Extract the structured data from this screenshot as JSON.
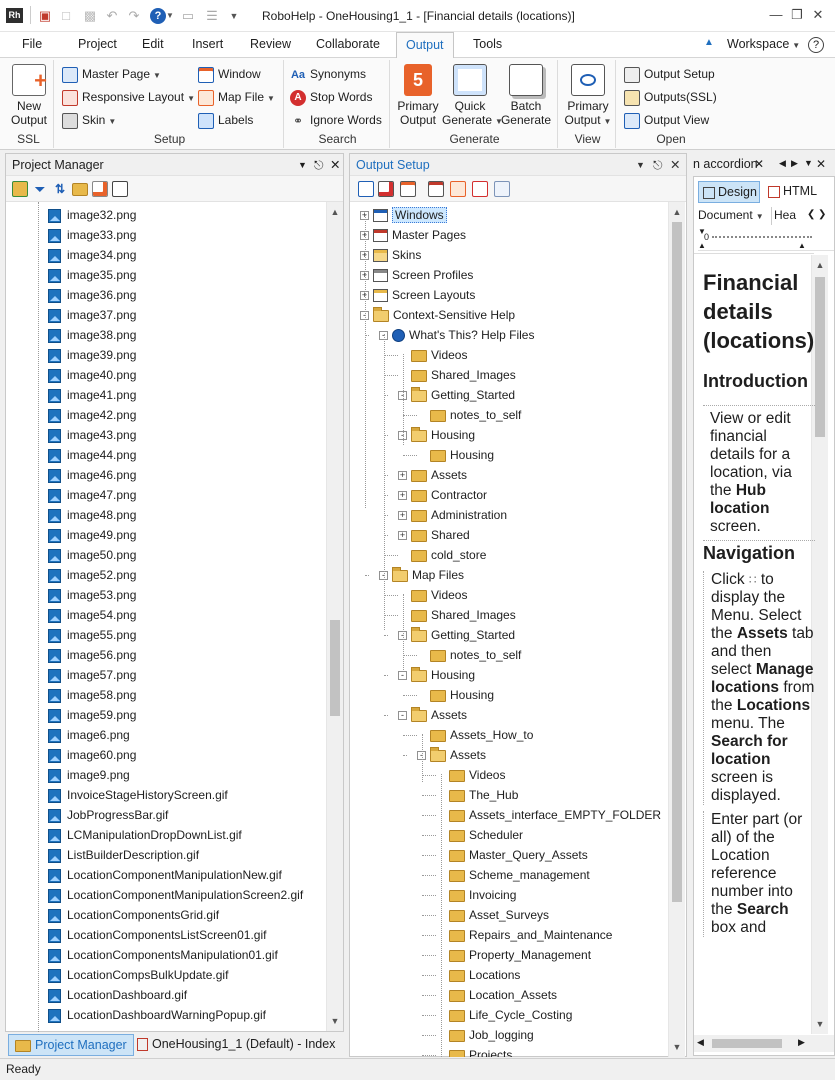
{
  "window": {
    "app_icon": "Rh",
    "title": "RoboHelp - OneHousing1_1 - [Financial details (locations)]"
  },
  "menu_tabs": [
    "File",
    "Project",
    "Edit",
    "Insert",
    "Review",
    "Collaborate",
    "Output",
    "Tools"
  ],
  "active_tab": "Output",
  "workspace_label": "Workspace",
  "ribbon": {
    "ssl": {
      "button": "New Output",
      "group": "SSL"
    },
    "setup": {
      "items": [
        "Master Page",
        "Responsive Layout",
        "Skin",
        "Window",
        "Map File",
        "Labels"
      ],
      "group": "Setup"
    },
    "search": {
      "items": [
        "Synonyms",
        "Stop Words",
        "Ignore Words"
      ],
      "group": "Search"
    },
    "generate": {
      "buttons": [
        "Primary Output",
        "Quick Generate",
        "Batch Generate"
      ],
      "group": "Generate"
    },
    "view": {
      "button": "Primary Output",
      "group": "View"
    },
    "open": {
      "items": [
        "Output Setup",
        "Outputs(SSL)",
        "Output View"
      ],
      "group": "Open"
    }
  },
  "project_manager": {
    "title": "Project Manager",
    "files": [
      "image32.png",
      "image33.png",
      "image34.png",
      "image35.png",
      "image36.png",
      "image37.png",
      "image38.png",
      "image39.png",
      "image40.png",
      "image41.png",
      "image42.png",
      "image43.png",
      "image44.png",
      "image46.png",
      "image47.png",
      "image48.png",
      "image49.png",
      "image50.png",
      "image52.png",
      "image53.png",
      "image54.png",
      "image55.png",
      "image56.png",
      "image57.png",
      "image58.png",
      "image59.png",
      "image6.png",
      "image60.png",
      "image9.png",
      "InvoiceStageHistoryScreen.gif",
      "JobProgressBar.gif",
      "LCManipulationDropDownList.gif",
      "ListBuilderDescription.gif",
      "LocationComponentManipulationNew.gif",
      "LocationComponentManipulationScreen2.gif",
      "LocationComponentsGrid.gif",
      "LocationComponentsListScreen01.gif",
      "LocationComponentsManipulation01.gif",
      "LocationCompsBulkUpdate.gif",
      "LocationDashboard.gif",
      "LocationDashboardWarningPopup.gif"
    ]
  },
  "output_setup": {
    "title": "Output Setup",
    "tree": [
      {
        "label": "Windows",
        "depth": 0,
        "exp": "+",
        "icon": "window",
        "selected": true
      },
      {
        "label": "Master Pages",
        "depth": 0,
        "exp": "+",
        "icon": "page"
      },
      {
        "label": "Skins",
        "depth": 0,
        "exp": "+",
        "icon": "skin"
      },
      {
        "label": "Screen Profiles",
        "depth": 0,
        "exp": "+",
        "icon": "profile"
      },
      {
        "label": "Screen Layouts",
        "depth": 0,
        "exp": "+",
        "icon": "layout"
      },
      {
        "label": "Context-Sensitive Help",
        "depth": 0,
        "exp": "-",
        "icon": "open"
      },
      {
        "label": "What's This? Help Files",
        "depth": 1,
        "exp": "-",
        "icon": "help"
      },
      {
        "label": "Videos",
        "depth": 2,
        "exp": "",
        "icon": "folder"
      },
      {
        "label": "Shared_Images",
        "depth": 2,
        "exp": "",
        "icon": "folder"
      },
      {
        "label": "Getting_Started",
        "depth": 2,
        "exp": "-",
        "icon": "open"
      },
      {
        "label": "notes_to_self",
        "depth": 3,
        "exp": "",
        "icon": "folder"
      },
      {
        "label": "Housing",
        "depth": 2,
        "exp": "-",
        "icon": "open"
      },
      {
        "label": "Housing",
        "depth": 3,
        "exp": "",
        "icon": "folder"
      },
      {
        "label": "Assets",
        "depth": 2,
        "exp": "+",
        "icon": "folder"
      },
      {
        "label": "Contractor",
        "depth": 2,
        "exp": "+",
        "icon": "folder"
      },
      {
        "label": "Administration",
        "depth": 2,
        "exp": "+",
        "icon": "folder"
      },
      {
        "label": "Shared",
        "depth": 2,
        "exp": "+",
        "icon": "folder"
      },
      {
        "label": "cold_store",
        "depth": 2,
        "exp": "",
        "icon": "folder"
      },
      {
        "label": "Map Files",
        "depth": 1,
        "exp": "-",
        "icon": "open"
      },
      {
        "label": "Videos",
        "depth": 2,
        "exp": "",
        "icon": "folder"
      },
      {
        "label": "Shared_Images",
        "depth": 2,
        "exp": "",
        "icon": "folder"
      },
      {
        "label": "Getting_Started",
        "depth": 2,
        "exp": "-",
        "icon": "open"
      },
      {
        "label": "notes_to_self",
        "depth": 3,
        "exp": "",
        "icon": "folder"
      },
      {
        "label": "Housing",
        "depth": 2,
        "exp": "-",
        "icon": "open"
      },
      {
        "label": "Housing",
        "depth": 3,
        "exp": "",
        "icon": "folder"
      },
      {
        "label": "Assets",
        "depth": 2,
        "exp": "-",
        "icon": "open"
      },
      {
        "label": "Assets_How_to",
        "depth": 3,
        "exp": "",
        "icon": "folder"
      },
      {
        "label": "Assets",
        "depth": 3,
        "exp": "-",
        "icon": "open"
      },
      {
        "label": "Videos",
        "depth": 4,
        "exp": "",
        "icon": "folder"
      },
      {
        "label": "The_Hub",
        "depth": 4,
        "exp": "",
        "icon": "folder"
      },
      {
        "label": "Assets_interface_EMPTY_FOLDER",
        "depth": 4,
        "exp": "",
        "icon": "folder"
      },
      {
        "label": "Scheduler",
        "depth": 4,
        "exp": "",
        "icon": "folder"
      },
      {
        "label": "Master_Query_Assets",
        "depth": 4,
        "exp": "",
        "icon": "folder"
      },
      {
        "label": "Scheme_management",
        "depth": 4,
        "exp": "",
        "icon": "folder"
      },
      {
        "label": "Invoicing",
        "depth": 4,
        "exp": "",
        "icon": "folder"
      },
      {
        "label": "Asset_Surveys",
        "depth": 4,
        "exp": "",
        "icon": "folder"
      },
      {
        "label": "Repairs_and_Maintenance",
        "depth": 4,
        "exp": "",
        "icon": "folder"
      },
      {
        "label": "Property_Management",
        "depth": 4,
        "exp": "",
        "icon": "folder"
      },
      {
        "label": "Locations",
        "depth": 4,
        "exp": "",
        "icon": "folder"
      },
      {
        "label": "Location_Assets",
        "depth": 4,
        "exp": "",
        "icon": "folder"
      },
      {
        "label": "Life_Cycle_Costing",
        "depth": 4,
        "exp": "",
        "icon": "folder"
      },
      {
        "label": "Job_logging",
        "depth": 4,
        "exp": "",
        "icon": "folder"
      },
      {
        "label": "Projects",
        "depth": 4,
        "exp": "",
        "icon": "folder"
      }
    ]
  },
  "editor": {
    "tab_title": "n accordion",
    "design_label": "Design",
    "html_label": "HTML",
    "style_select": "Document",
    "style_select2": "Hea",
    "ruler_zero": "0",
    "heading": "Financial details (locations)",
    "intro_heading": "Introduction",
    "intro_text_pre": "View or edit financial details for a location, via the ",
    "intro_bold": "Hub location",
    "intro_text_post": " screen.",
    "nav_heading": "Navigation",
    "nav_text": [
      "Click ",
      " to display the Menu. Select the ",
      "Assets",
      " tab and then select ",
      "Manage locations",
      " from the ",
      "Locations",
      " menu. The ",
      "Search for location",
      " screen is displayed."
    ],
    "enter_text": [
      "Enter part (or all) of the Location reference number into the ",
      "Search",
      " box and"
    ]
  },
  "bottom_tabs": {
    "active": "Project Manager",
    "other": "OneHousing1_1 (Default) - Index"
  },
  "status": "Ready"
}
